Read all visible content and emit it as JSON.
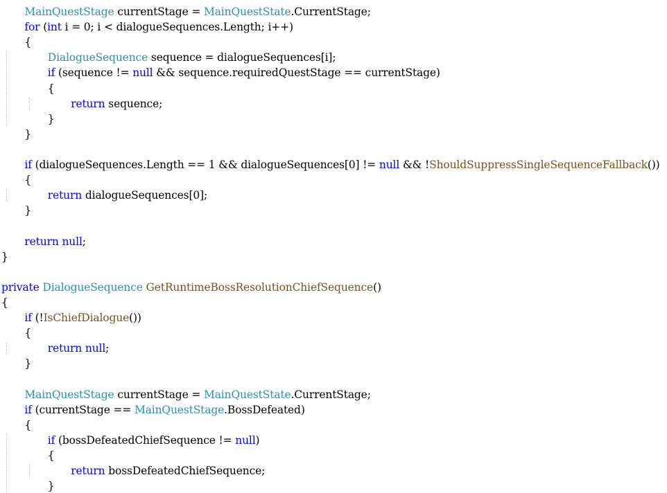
{
  "editor": {
    "lines": [
      {
        "indent": 1,
        "tokens": [
          {
            "t": "MainQuestStage",
            "k": "ty"
          },
          {
            "t": " currentStage = ",
            "k": "nm"
          },
          {
            "t": "MainQuestState",
            "k": "ty"
          },
          {
            "t": ".CurrentStage;",
            "k": "nm"
          }
        ]
      },
      {
        "indent": 1,
        "tokens": [
          {
            "t": "for",
            "k": "kw"
          },
          {
            "t": " (",
            "k": "nm"
          },
          {
            "t": "int",
            "k": "kw"
          },
          {
            "t": " i = 0; i < dialogueSequences.Length; i++)",
            "k": "nm"
          }
        ]
      },
      {
        "indent": 1,
        "tokens": [
          {
            "t": "{",
            "k": "nm"
          }
        ]
      },
      {
        "indent": 2,
        "tokens": [
          {
            "t": "DialogueSequence",
            "k": "ty"
          },
          {
            "t": " sequence = dialogueSequences[i];",
            "k": "nm"
          }
        ]
      },
      {
        "indent": 2,
        "tokens": [
          {
            "t": "if",
            "k": "kw"
          },
          {
            "t": " (sequence != ",
            "k": "nm"
          },
          {
            "t": "null",
            "k": "kw"
          },
          {
            "t": " && sequence.requiredQuestStage == currentStage)",
            "k": "nm"
          }
        ]
      },
      {
        "indent": 2,
        "tokens": [
          {
            "t": "{",
            "k": "nm"
          }
        ]
      },
      {
        "indent": 3,
        "tokens": [
          {
            "t": "return",
            "k": "kw"
          },
          {
            "t": " sequence;",
            "k": "nm"
          }
        ]
      },
      {
        "indent": 2,
        "tokens": [
          {
            "t": "}",
            "k": "nm"
          }
        ]
      },
      {
        "indent": 1,
        "tokens": [
          {
            "t": "}",
            "k": "nm"
          }
        ]
      },
      {
        "indent": 0,
        "tokens": []
      },
      {
        "indent": 1,
        "tokens": [
          {
            "t": "if",
            "k": "kw"
          },
          {
            "t": " (dialogueSequences.Length == 1 && dialogueSequences[0] != ",
            "k": "nm"
          },
          {
            "t": "null",
            "k": "kw"
          },
          {
            "t": " && !",
            "k": "nm"
          },
          {
            "t": "ShouldSuppressSingleSequenceFallback",
            "k": "mt"
          },
          {
            "t": "())",
            "k": "nm"
          }
        ]
      },
      {
        "indent": 1,
        "tokens": [
          {
            "t": "{",
            "k": "nm"
          }
        ]
      },
      {
        "indent": 2,
        "tokens": [
          {
            "t": "return",
            "k": "kw"
          },
          {
            "t": " dialogueSequences[0];",
            "k": "nm"
          }
        ]
      },
      {
        "indent": 1,
        "tokens": [
          {
            "t": "}",
            "k": "nm"
          }
        ]
      },
      {
        "indent": 0,
        "tokens": []
      },
      {
        "indent": 1,
        "tokens": [
          {
            "t": "return",
            "k": "kw"
          },
          {
            "t": " ",
            "k": "nm"
          },
          {
            "t": "null",
            "k": "kw"
          },
          {
            "t": ";",
            "k": "nm"
          }
        ]
      },
      {
        "indent": 0,
        "tokens": [
          {
            "t": "}",
            "k": "nm"
          }
        ]
      },
      {
        "indent": 0,
        "tokens": []
      },
      {
        "indent": 0,
        "tokens": [
          {
            "t": "private",
            "k": "kw"
          },
          {
            "t": " ",
            "k": "nm"
          },
          {
            "t": "DialogueSequence",
            "k": "ty"
          },
          {
            "t": " ",
            "k": "nm"
          },
          {
            "t": "GetRuntimeBossResolutionChiefSequence",
            "k": "mt"
          },
          {
            "t": "()",
            "k": "nm"
          }
        ]
      },
      {
        "indent": 0,
        "tokens": [
          {
            "t": "{",
            "k": "nm"
          }
        ]
      },
      {
        "indent": 1,
        "tokens": [
          {
            "t": "if",
            "k": "kw"
          },
          {
            "t": " (!",
            "k": "nm"
          },
          {
            "t": "IsChiefDialogue",
            "k": "mt"
          },
          {
            "t": "())",
            "k": "nm"
          }
        ]
      },
      {
        "indent": 1,
        "tokens": [
          {
            "t": "{",
            "k": "nm"
          }
        ]
      },
      {
        "indent": 2,
        "tokens": [
          {
            "t": "return",
            "k": "kw"
          },
          {
            "t": " ",
            "k": "nm"
          },
          {
            "t": "null",
            "k": "kw"
          },
          {
            "t": ";",
            "k": "nm"
          }
        ]
      },
      {
        "indent": 1,
        "tokens": [
          {
            "t": "}",
            "k": "nm"
          }
        ]
      },
      {
        "indent": 0,
        "tokens": []
      },
      {
        "indent": 1,
        "tokens": [
          {
            "t": "MainQuestStage",
            "k": "ty"
          },
          {
            "t": " currentStage = ",
            "k": "nm"
          },
          {
            "t": "MainQuestState",
            "k": "ty"
          },
          {
            "t": ".CurrentStage;",
            "k": "nm"
          }
        ]
      },
      {
        "indent": 1,
        "tokens": [
          {
            "t": "if",
            "k": "kw"
          },
          {
            "t": " (currentStage == ",
            "k": "nm"
          },
          {
            "t": "MainQuestStage",
            "k": "ty"
          },
          {
            "t": ".BossDefeated)",
            "k": "nm"
          }
        ]
      },
      {
        "indent": 1,
        "tokens": [
          {
            "t": "{",
            "k": "nm"
          }
        ]
      },
      {
        "indent": 2,
        "tokens": [
          {
            "t": "if",
            "k": "kw"
          },
          {
            "t": " (bossDefeatedChiefSequence != ",
            "k": "nm"
          },
          {
            "t": "null",
            "k": "kw"
          },
          {
            "t": ")",
            "k": "nm"
          }
        ]
      },
      {
        "indent": 2,
        "tokens": [
          {
            "t": "{",
            "k": "nm"
          }
        ]
      },
      {
        "indent": 3,
        "tokens": [
          {
            "t": "return",
            "k": "kw"
          },
          {
            "t": " bossDefeatedChiefSequence;",
            "k": "nm"
          }
        ]
      },
      {
        "indent": 2,
        "tokens": [
          {
            "t": "}",
            "k": "nm"
          }
        ]
      }
    ],
    "colors": {
      "keyword": "#0000ff",
      "type": "#2b91af",
      "method": "#74531f",
      "text": "#000000",
      "background": "#ffffff",
      "guide": "#c8c8c8"
    }
  }
}
